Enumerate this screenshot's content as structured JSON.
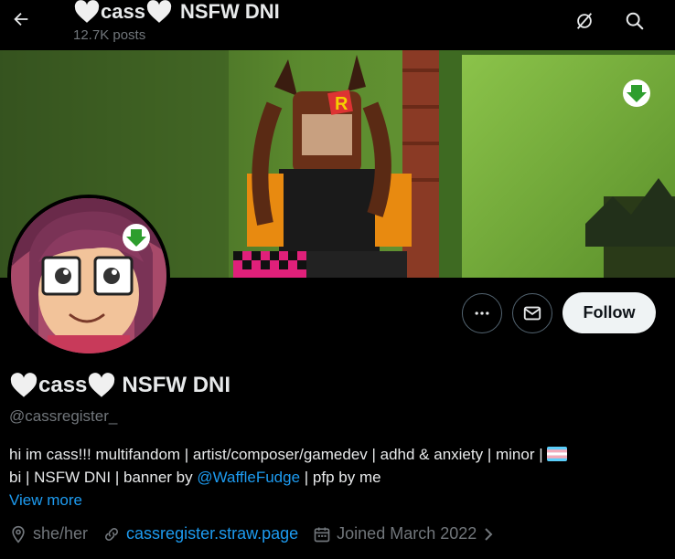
{
  "header": {
    "display_name": "cass",
    "name_suffix": "NSFW DNI",
    "post_count": "12.7K posts"
  },
  "actions": {
    "follow_label": "Follow"
  },
  "profile": {
    "display_name": "cass",
    "name_suffix": "NSFW DNI",
    "handle": "@cassregister_",
    "bio_line1_text": "hi im cass!!! multifandom | artist/composer/gamedev | adhd & anxiety | minor | ",
    "bio_line2_prefix": "bi | NSFW DNI | banner by ",
    "bio_mention": "@WaffleFudge",
    "bio_line2_suffix": " | pfp by me",
    "view_more": "View more",
    "pronouns": "she/her",
    "website": "cassregister.straw.page",
    "joined": "Joined March 2022"
  },
  "colors": {
    "accent": "#1d9bf0",
    "text": "#e7e9ea",
    "muted": "#71767b",
    "background": "#000000"
  },
  "icons": {
    "back": "arrow-left-icon",
    "grok": "grok-icon",
    "search": "search-icon",
    "more": "more-dots-icon",
    "message": "envelope-icon",
    "location": "location-pin-icon",
    "link": "link-icon",
    "calendar": "calendar-icon",
    "chevron": "chevron-right-icon"
  }
}
